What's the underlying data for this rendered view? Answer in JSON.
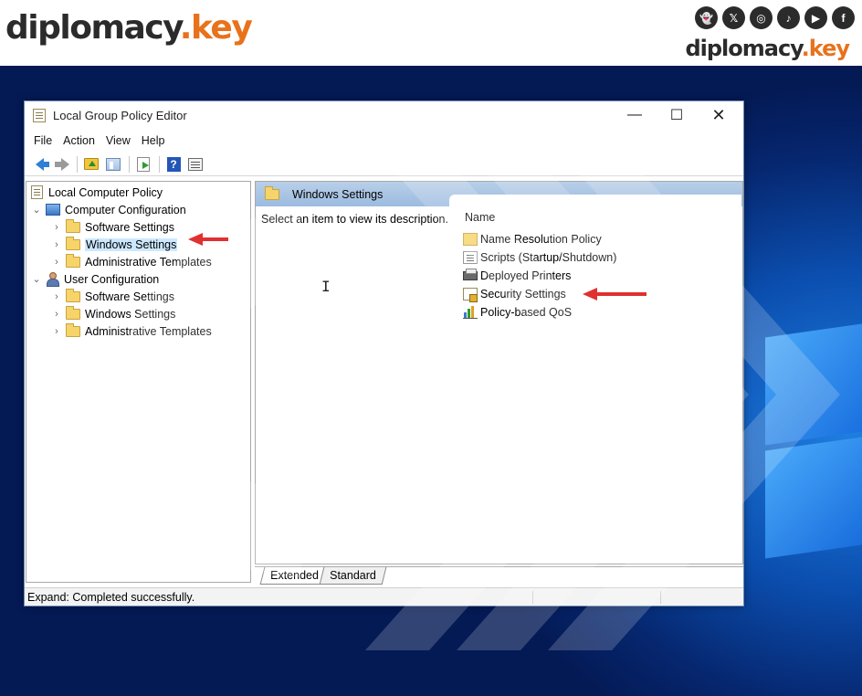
{
  "brand": {
    "logo_word": "diplomacy",
    "logo_dot": ".",
    "logo_suffix": "key",
    "social_icons": [
      "snapchat-icon",
      "x-icon",
      "instagram-icon",
      "tiktok-icon",
      "youtube-icon",
      "facebook-icon"
    ],
    "colors": {
      "accent": "#e8721c",
      "dark": "#2b2b2b"
    }
  },
  "window": {
    "title": "Local Group Policy Editor",
    "controls": {
      "minimize": "—",
      "maximize": "☐",
      "close": "✕"
    }
  },
  "menu": [
    "File",
    "Action",
    "View",
    "Help"
  ],
  "toolbar": [
    "back-icon",
    "forward-icon",
    "up-folder-icon",
    "show-hide-tree-icon",
    "export-list-icon",
    "help-icon",
    "view-icon"
  ],
  "tree": {
    "root": "Local Computer Policy",
    "computer": {
      "label": "Computer Configuration",
      "children": [
        "Software Settings",
        "Windows Settings",
        "Administrative Templates"
      ]
    },
    "user": {
      "label": "User Configuration",
      "children": [
        "Software Settings",
        "Windows Settings",
        "Administrative Templates"
      ]
    },
    "selected": "Windows Settings"
  },
  "right": {
    "header": "Windows Settings",
    "description": "Select an item to view its description.",
    "column_name": "Name",
    "items": [
      "Name Resolution Policy",
      "Scripts (Startup/Shutdown)",
      "Deployed Printers",
      "Security Settings",
      "Policy-based QoS"
    ]
  },
  "tabs": [
    "Extended",
    "Standard"
  ],
  "status": "Expand:  Completed successfully."
}
